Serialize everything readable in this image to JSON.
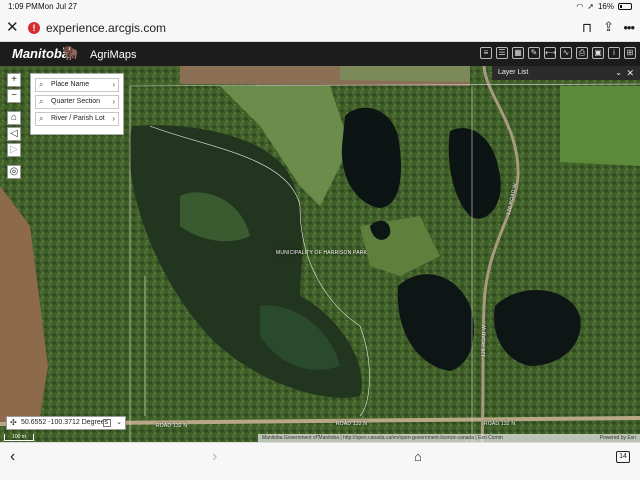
{
  "status": {
    "time": "1:09 PM",
    "date": "Mon Jul 27",
    "battery": "16%"
  },
  "browser": {
    "url": "experience.arcgis.com",
    "tab_count": "14"
  },
  "header": {
    "brand": "Manitoba",
    "app_title": "AgriMaps"
  },
  "search": {
    "items": [
      {
        "label": "Place Name"
      },
      {
        "label": "Quarter Section"
      },
      {
        "label": "River / Parish Lot"
      }
    ]
  },
  "layer_list": {
    "title": "Layer List"
  },
  "map": {
    "municipality_label": "MUNICIPALITY OF HARRISON PARK",
    "road_labels": [
      "ROAD 132 N",
      "ROAD 132 N",
      "ROAD 132 N",
      "126 ROAD W",
      "126 ROAD W"
    ],
    "coordinates": "50.6552 -100.3712 Degrees",
    "scale": "100 m",
    "attribution": "Manitoba Government of Manitoba | http://open.canada.ca/en/open-government-licence-canada | Esri Comm",
    "powered_by": "Powered by Esri"
  }
}
